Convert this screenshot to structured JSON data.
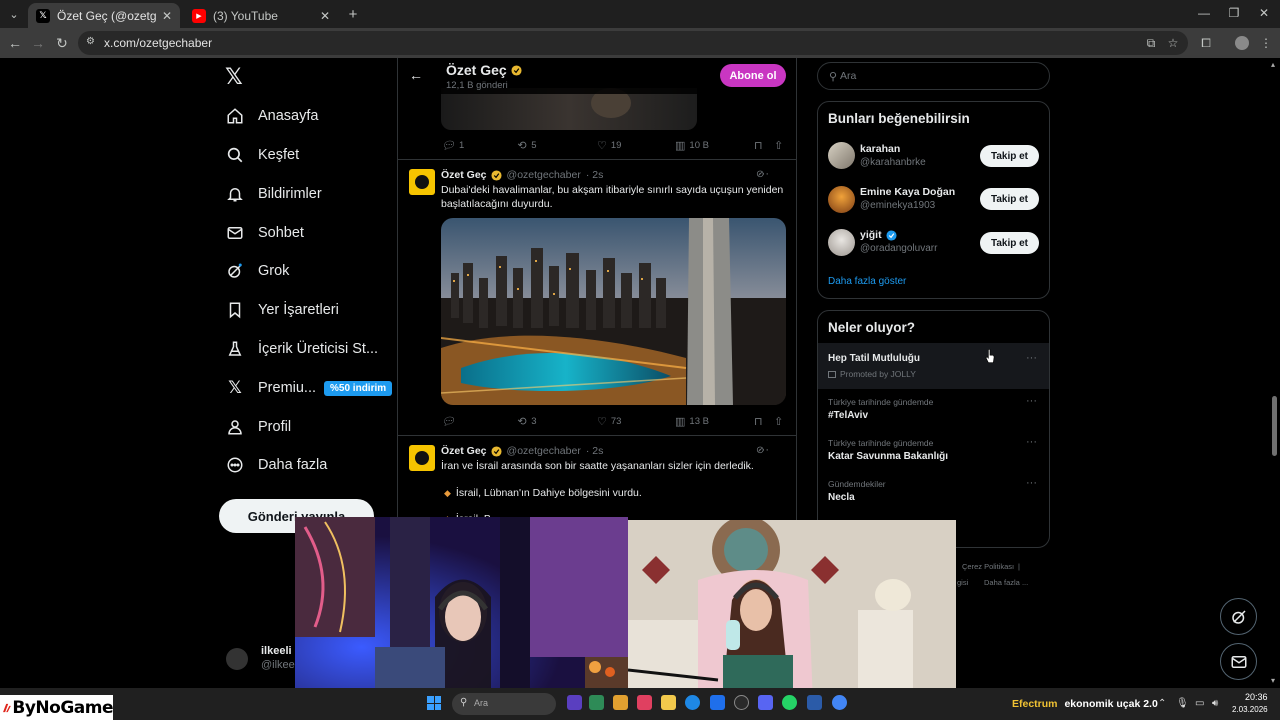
{
  "browser": {
    "tabs": [
      {
        "title": "Özet Geç (@ozetgechaber) / X",
        "favicon": "x-icon",
        "active": true
      },
      {
        "title": "(3) YouTube",
        "favicon": "youtube-icon",
        "active": false
      }
    ],
    "new_tab": "+",
    "url": "x.com/ozetgechaber"
  },
  "sidebar": {
    "items": [
      {
        "label": "Anasayfa",
        "icon": "home-icon"
      },
      {
        "label": "Keşfet",
        "icon": "search-icon"
      },
      {
        "label": "Bildirimler",
        "icon": "bell-icon"
      },
      {
        "label": "Sohbet",
        "icon": "mail-icon"
      },
      {
        "label": "Grok",
        "icon": "grok-icon"
      },
      {
        "label": "Yer İşaretleri",
        "icon": "bookmark-icon"
      },
      {
        "label": "İçerik Üreticisi St...",
        "icon": "flask-icon"
      },
      {
        "label": "Premiu...",
        "icon": "x-icon",
        "badge": "%50 indirim"
      },
      {
        "label": "Profil",
        "icon": "user-icon"
      },
      {
        "label": "Daha fazla",
        "icon": "more-circle-icon"
      }
    ],
    "post_button": "Gönderi yayınla",
    "account": {
      "name": "ilkeeli",
      "handle": "@ilkee"
    }
  },
  "profile_header": {
    "name": "Özet Geç",
    "posts_count": "12,1 B gönderi",
    "subscribe": "Abone ol"
  },
  "feed": {
    "prev_tweet_actions": {
      "replies": "1",
      "reposts": "5",
      "likes": "19",
      "views": "10 B"
    },
    "tweets": [
      {
        "name": "Özet Geç",
        "handle": "@ozetgechaber",
        "time": "· 2s",
        "text": "Dubai'deki havalimanlar, bu akşam itibariyle sınırlı sayıda uçuşun yeniden başlatılacağını duyurdu.",
        "replies": "",
        "reposts": "3",
        "likes": "73",
        "views": "13 B"
      },
      {
        "name": "Özet Geç",
        "handle": "@ozetgechaber",
        "time": "· 2s",
        "text": "İran ve İsrail arasında son bir saatte yaşananları sizler için derledik.",
        "bullets": [
          "İsrail, Lübnan'ın Dahiye bölgesini vurdu.",
          "İsrail, B..."
        ]
      }
    ]
  },
  "search": {
    "placeholder": "Ara"
  },
  "suggestions": {
    "title": "Bunları beğenebilirsin",
    "users": [
      {
        "name": "karahan",
        "handle": "@karahanbrke",
        "verified": false,
        "button": "Takip et"
      },
      {
        "name": "Emine Kaya Doğan",
        "handle": "@eminekya1903",
        "verified": false,
        "button": "Takip et"
      },
      {
        "name": "yiğit",
        "handle": "@oradangoluvarr",
        "verified": true,
        "button": "Takip et"
      }
    ],
    "show_more": "Daha fazla göster"
  },
  "trends": {
    "title": "Neler oluyor?",
    "items": [
      {
        "name": "Hep Tatil Mutluluğu",
        "meta": "Promoted by JOLLY",
        "promoted": true
      },
      {
        "meta": "Türkiye tarihinde gündemde",
        "name": "#TelAviv"
      },
      {
        "meta": "Türkiye tarihinde gündemde",
        "name": "Katar Savunma Bakanlığı"
      },
      {
        "meta": "Gündemdekiler",
        "name": "Necla"
      }
    ]
  },
  "footer": {
    "links": [
      "Çerez Politikası",
      "|",
      "gisi",
      "Daha fazla ..."
    ]
  },
  "taskbar": {
    "search_placeholder": "Ara",
    "ticker_source": "Efectrum",
    "ticker_title": "ekonomik uçak 2.0",
    "time": "20:36",
    "date": "2.03.2026"
  },
  "watermark": {
    "text": "ByNoGame"
  },
  "colors": {
    "accent": "#1d9bf0",
    "subscribe": "#c936c2",
    "background": "#000000",
    "promo_badge": "#1d9bf0"
  }
}
